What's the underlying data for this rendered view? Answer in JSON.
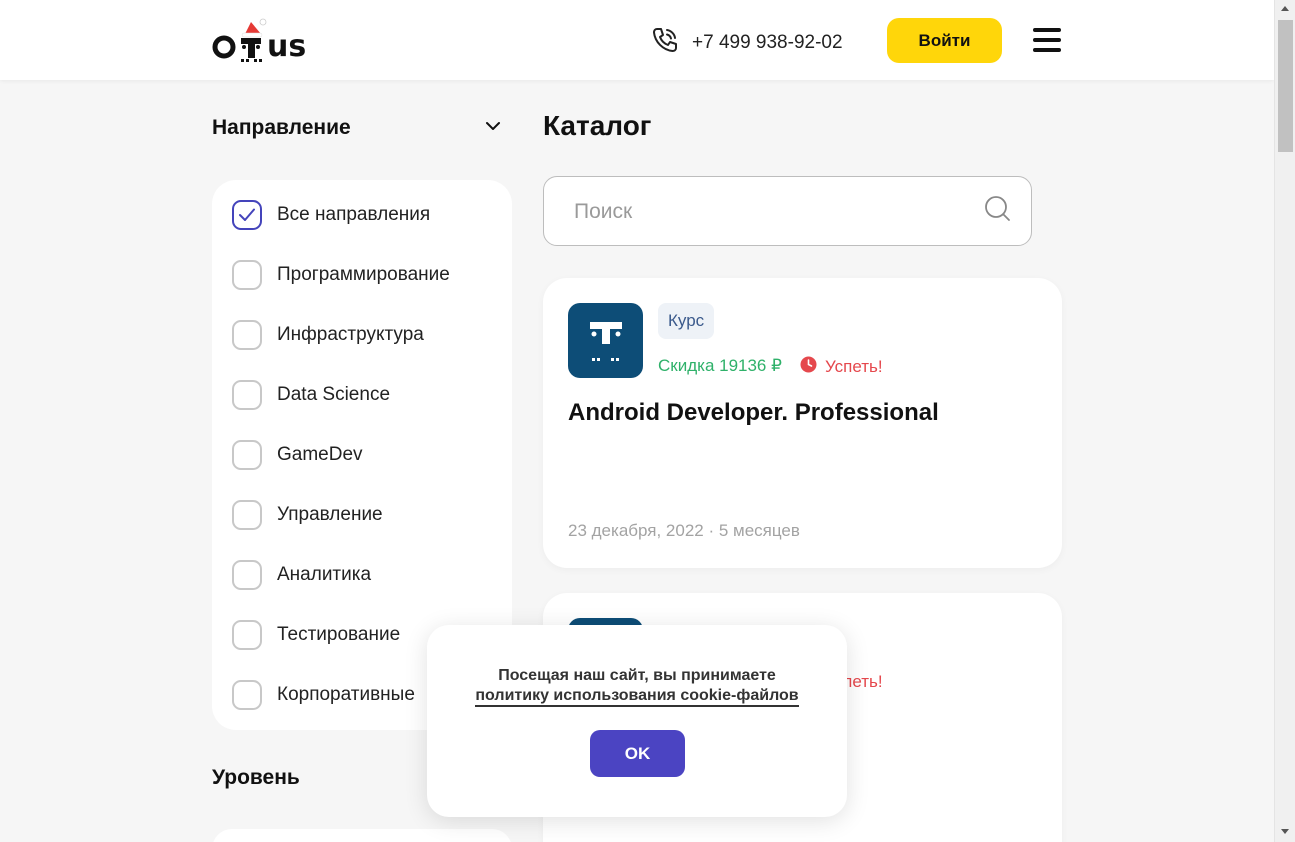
{
  "header": {
    "logo_text": "otus",
    "phone": "+7 499 938-92-02",
    "login_label": "Войти"
  },
  "filters": {
    "direction_title": "Направление",
    "items": [
      {
        "label": "Все направления",
        "checked": true
      },
      {
        "label": "Программирование",
        "checked": false
      },
      {
        "label": "Инфраструктура",
        "checked": false
      },
      {
        "label": "Data Science",
        "checked": false
      },
      {
        "label": "GameDev",
        "checked": false
      },
      {
        "label": "Управление",
        "checked": false
      },
      {
        "label": "Аналитика",
        "checked": false
      },
      {
        "label": "Тестирование",
        "checked": false
      },
      {
        "label": "Корпоративные",
        "checked": false
      }
    ],
    "level_title": "Уровень"
  },
  "catalog": {
    "title": "Каталог",
    "search_placeholder": "Поиск",
    "cards": [
      {
        "type": "Курс",
        "discount": "Скидка 19136 ₽",
        "hurry": "Успеть!",
        "title": "Android Developer. Professional",
        "meta": "23 декабря, 2022 · 5 месяцев"
      },
      {
        "type": "",
        "discount": "",
        "hurry": "Успеть!",
        "title": "",
        "meta": ""
      }
    ]
  },
  "cookie": {
    "text": "Посещая наш сайт, вы принимаете",
    "link": "политику использования cookie-файлов",
    "ok_label": "OK"
  },
  "colors": {
    "accent_yellow": "#ffd60a",
    "ok_button": "#4b44c2",
    "discount_green": "#2fb16a",
    "hurry_red": "#e5484d",
    "checkbox_checked": "#4444bb",
    "course_logo_bg": "#0d4d77"
  },
  "icons": {
    "phone": "phone-icon",
    "menu": "burger-menu-icon",
    "search": "search-icon",
    "chevron": "chevron-down-icon",
    "clock": "clock-icon",
    "check": "check-icon"
  }
}
